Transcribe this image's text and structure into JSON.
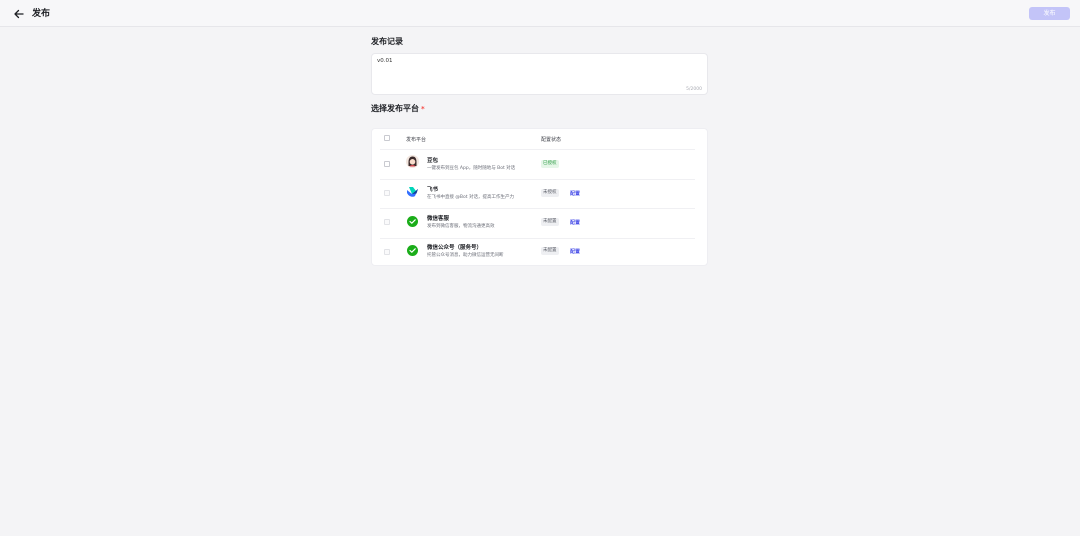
{
  "header": {
    "title": "发布",
    "publish_label": "发布"
  },
  "record": {
    "title": "发布记录",
    "value": "v0.01",
    "counter": "5/2000"
  },
  "platforms_section": {
    "title": "选择发布平台",
    "required_mark": "*"
  },
  "table": {
    "col_platform": "发布平台",
    "col_status": "配置状态"
  },
  "platforms": [
    {
      "name": "豆包",
      "desc": "一键发布到豆包 App，随时随地与 Bot 对话",
      "status": "已授权",
      "status_type": "ok",
      "config": "",
      "icon": "doubao-logo-icon"
    },
    {
      "name": "飞书",
      "desc": "在飞书中直接 @Bot 对话，提高工作生产力",
      "status": "未授权",
      "status_type": "no",
      "config": "配置",
      "icon": "feishu-logo-icon"
    },
    {
      "name": "微信客服",
      "desc": "发布到微信客服，物流沟通更高效",
      "status": "未配置",
      "status_type": "no",
      "config": "配置",
      "icon": "wechat-logo-icon"
    },
    {
      "name": "微信公众号（服务号）",
      "desc": "托管公众号消息，助力微信运营无间断",
      "status": "未配置",
      "status_type": "no",
      "config": "配置",
      "icon": "wechat-logo-icon"
    }
  ],
  "colors": {
    "accent": "#4d53e8",
    "publish_disabled": "#c3c4f8",
    "success": "#2e9c46",
    "wechat_green": "#1aad19"
  }
}
